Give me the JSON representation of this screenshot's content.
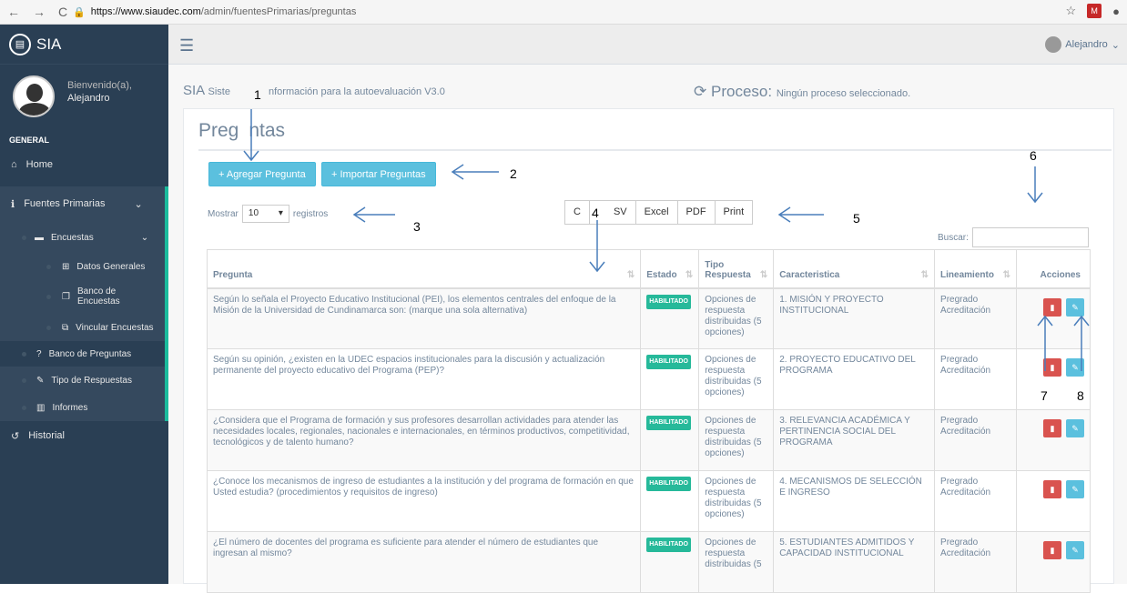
{
  "browser": {
    "host": "https://www.siaudec.com",
    "path": "/admin/fuentesPrimarias/preguntas",
    "lock_icon": "lock-icon"
  },
  "sidebar": {
    "brand": "SIA",
    "welcome": "Bienvenido(a),",
    "user_name": "Alejandro",
    "section": "GENERAL",
    "items": [
      {
        "label": "Home",
        "icon": "home-icon"
      },
      {
        "label": "Fuentes Primarias",
        "icon": "info-icon"
      },
      {
        "label": "Encuestas",
        "icon": "file-icon"
      },
      {
        "label": "Datos Generales",
        "icon": "grid-icon"
      },
      {
        "label": "Banco de Encuestas",
        "icon": "copy-icon"
      },
      {
        "label": "Vincular Encuestas",
        "icon": "external-icon"
      },
      {
        "label": "Banco de Preguntas",
        "icon": "question-icon"
      },
      {
        "label": "Tipo de Respuestas",
        "icon": "edit-icon"
      },
      {
        "label": "Informes",
        "icon": "chart-icon"
      },
      {
        "label": "Historial",
        "icon": "history-icon"
      }
    ]
  },
  "topbar": {
    "user": "Alejandro"
  },
  "header": {
    "app": "SIA",
    "app_desc_a": "Siste",
    "app_desc_b": "nformación para la autoevaluación V3.0",
    "proceso_label": "Proceso:",
    "proceso_value": "Ningún proceso seleccionado."
  },
  "panel": {
    "title_a": "Preg",
    "title_b": "ntas",
    "add_button": "+ Agregar Pregunta",
    "import_button": "+ Importar Preguntas",
    "mostrar": "Mostrar",
    "page_size": "10",
    "registros": "registros",
    "export": [
      "C",
      "SV",
      "Excel",
      "PDF",
      "Print"
    ],
    "buscar": "Buscar:"
  },
  "table": {
    "headers": [
      "Pregunta",
      "Estado",
      "Tipo Respuesta",
      "Caracteristica",
      "Lineamiento",
      "Acciones"
    ],
    "rows": [
      {
        "pregunta": "Según lo señala el Proyecto Educativo Institucional (PEI), los elementos centrales del enfoque de la Misión de la Universidad de Cundinamarca son: (marque una sola alternativa)",
        "estado": "HABILITADO",
        "tipo": "Opciones de respuesta distribuidas (5 opciones)",
        "caracteristica": "1. MISIÓN Y PROYECTO INSTITUCIONAL",
        "lineamiento": "Pregrado Acreditación"
      },
      {
        "pregunta": "Según su opinión, ¿existen en la UDEC espacios institucionales para la discusión y actualización permanente del proyecto educativo del Programa (PEP)?",
        "estado": "HABILITADO",
        "tipo": "Opciones de respuesta distribuidas (5 opciones)",
        "caracteristica": "2. PROYECTO EDUCATIVO DEL PROGRAMA",
        "lineamiento": "Pregrado Acreditación"
      },
      {
        "pregunta": "¿Considera que el Programa de formación y sus profesores desarrollan actividades para atender las necesidades locales, regionales, nacionales e internacionales, en términos productivos, competitividad, tecnológicos y de talento humano?",
        "estado": "HABILITADO",
        "tipo": "Opciones de respuesta distribuidas (5 opciones)",
        "caracteristica": "3. RELEVANCIA ACADÉMICA Y PERTINENCIA SOCIAL DEL PROGRAMA",
        "lineamiento": "Pregrado Acreditación"
      },
      {
        "pregunta": "¿Conoce los mecanismos de ingreso de estudiantes a la institución y del programa de formación en que Usted estudia? (procedimientos y requisitos de ingreso)",
        "estado": "HABILITADO",
        "tipo": "Opciones de respuesta distribuidas (5 opciones)",
        "caracteristica": "4. MECANISMOS DE SELECCIÓN E INGRESO",
        "lineamiento": "Pregrado Acreditación"
      },
      {
        "pregunta": "¿El número de docentes del programa es suficiente para atender el número de estudiantes que ingresan al mismo?",
        "estado": "HABILITADO",
        "tipo": "Opciones de respuesta distribuidas (5",
        "caracteristica": "5. ESTUDIANTES ADMITIDOS Y CAPACIDAD INSTITUCIONAL",
        "lineamiento": "Pregrado Acreditación"
      }
    ]
  },
  "annotations": [
    "1",
    "2",
    "3",
    "4",
    "5",
    "6",
    "7",
    "8"
  ]
}
